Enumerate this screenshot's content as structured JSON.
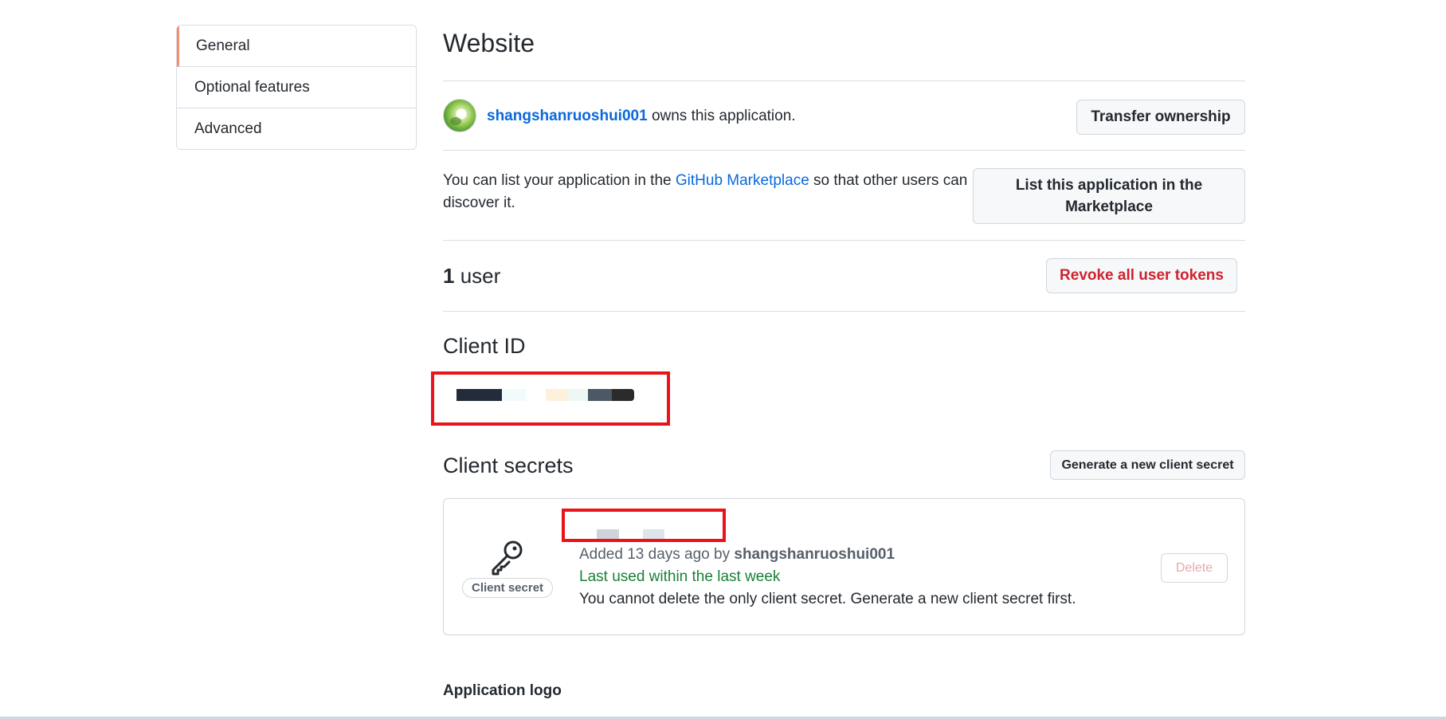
{
  "sidebar": {
    "items": [
      {
        "label": "General"
      },
      {
        "label": "Optional features"
      },
      {
        "label": "Advanced"
      }
    ]
  },
  "page_title": "Website",
  "owner": {
    "username": "shangshanruoshui001",
    "suffix": " owns this application.",
    "transfer_button": "Transfer ownership"
  },
  "marketplace": {
    "text_before": "You can list your application in the ",
    "link": "GitHub Marketplace",
    "text_after": " so that other users can discover it.",
    "button": "List this application in the Marketplace"
  },
  "users": {
    "count": "1",
    "label": " user",
    "revoke_button": "Revoke all user tokens"
  },
  "client_id": {
    "heading": "Client ID"
  },
  "client_secrets": {
    "heading": "Client secrets",
    "generate_button": "Generate a new client secret",
    "secret": {
      "badge": "Client secret",
      "added_prefix": "Added 13 days ago by ",
      "added_by": "shangshanruoshui001",
      "last_used": "Last used within the last week",
      "note": "You cannot delete the only client secret. Generate a new client secret first.",
      "delete_button": "Delete"
    }
  },
  "application_logo": {
    "heading": "Application logo"
  },
  "colors": {
    "accent_link": "#0969da",
    "active_tab_border": "#fd8c73",
    "danger": "#cf222e",
    "success": "#1a7f37",
    "redaction_frame": "#e8141a"
  },
  "icons": {
    "secret_icon": "key-icon"
  }
}
